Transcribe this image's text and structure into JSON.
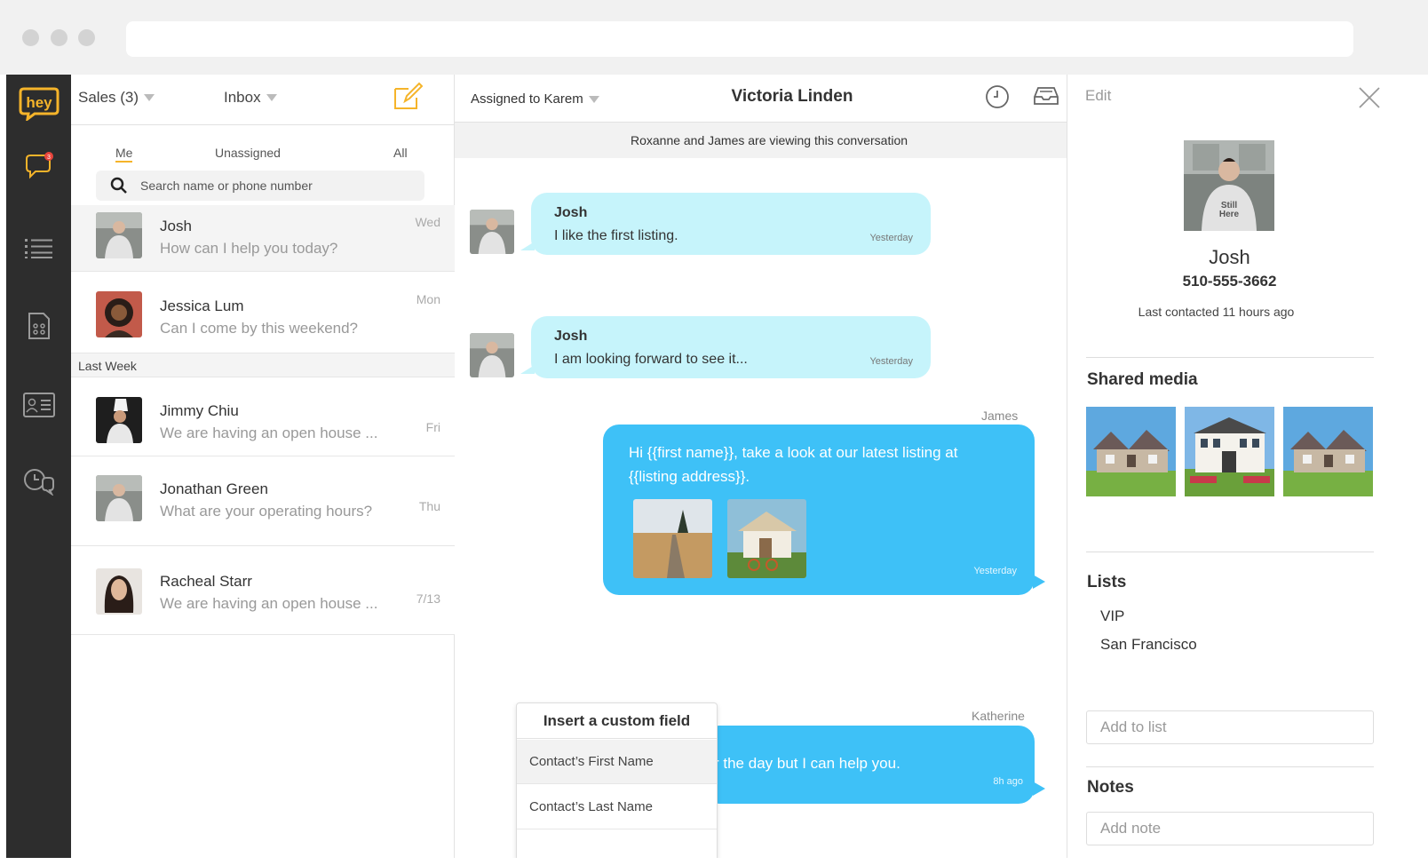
{
  "app": {
    "logo_text": "hey",
    "unread_badge": "3"
  },
  "inbox": {
    "team_selector": "Sales (3)",
    "folder_selector": "Inbox",
    "filters": [
      "Me",
      "Unassigned",
      "All"
    ],
    "search_placeholder": "Search name or phone number",
    "section_last_week": "Last Week",
    "conversations": [
      {
        "name": "Josh",
        "preview": "How can I help you today?",
        "day": "Wed"
      },
      {
        "name": "Jessica Lum",
        "preview": "Can I come by this weekend?",
        "day": "Mon"
      },
      {
        "name": "Jimmy Chiu",
        "preview": "We are having an open house ...",
        "day": "Fri"
      },
      {
        "name": "Jonathan Green",
        "preview": "What are your operating hours?",
        "day": "Thu"
      },
      {
        "name": "Racheal Starr",
        "preview": "We are having an open house ...",
        "day": "7/13"
      }
    ]
  },
  "chat": {
    "assigned_to": "Assigned to Karem",
    "title": "Victoria Linden",
    "viewing_notice": "Roxanne and James are viewing this conversation",
    "messages_in": [
      {
        "sender": "Josh",
        "body": "I like the first listing.",
        "time": "Yesterday"
      },
      {
        "sender": "Josh",
        "body": "I am looking forward to see it...",
        "time": "Yesterday"
      }
    ],
    "message_out_1": {
      "agent": "James",
      "line1": "Hi {{first name}}, take a look at our latest listing at",
      "line2": "{{listing address}}.",
      "time": "Yesterday"
    },
    "message_out_2": {
      "agent": "Katherine",
      "body": "r the day but I can help you.",
      "time": "8h ago"
    },
    "custom_field_popup": {
      "title": "Insert a custom field",
      "items": [
        "Contact’s First Name",
        "Contact’s Last Name"
      ]
    }
  },
  "contact": {
    "edit_label": "Edit",
    "name": "Josh",
    "phone": "510-555-3662",
    "last_contacted": "Last contacted 11 hours ago",
    "shared_media_title": "Shared media",
    "lists_title": "Lists",
    "lists": [
      "VIP",
      "San Francisco"
    ],
    "add_to_list_placeholder": "Add to list",
    "notes_title": "Notes",
    "add_note_placeholder": "Add note"
  },
  "colors": {
    "brand": "#f5b42a",
    "rail": "#2d2d2d",
    "incoming_bubble": "#c6f4fb",
    "outgoing_bubble": "#3ec1f7"
  }
}
